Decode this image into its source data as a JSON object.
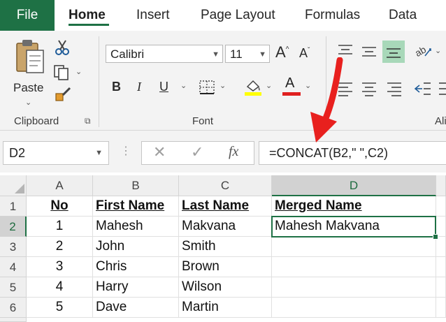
{
  "tabs": [
    "File",
    "Home",
    "Insert",
    "Page Layout",
    "Formulas",
    "Data"
  ],
  "ribbon": {
    "clipboard": {
      "paste_label": "Paste",
      "group_label": "Clipboard"
    },
    "font": {
      "font_name": "Calibri",
      "font_size": "11",
      "bold": "B",
      "italic": "I",
      "underline": "U",
      "font_color_glyph": "A",
      "grow_glyph": "A",
      "shrink_glyph": "A",
      "group_label": "Font",
      "highlight_color": "#ffff00",
      "font_color": "#e0201f"
    },
    "alignment": {
      "group_label_partial": "Ali"
    }
  },
  "formula_bar": {
    "name_box": "D2",
    "cancel_glyph": "✕",
    "enter_glyph": "✓",
    "fx_glyph": "fx",
    "formula": "=CONCAT(B2,\" \",C2)"
  },
  "grid": {
    "columns": [
      "A",
      "B",
      "C",
      "D"
    ],
    "rows": [
      "1",
      "2",
      "3",
      "4",
      "5",
      "6"
    ],
    "selected_cell": "D2",
    "headers": [
      "No",
      "First Name",
      "Last Name",
      "Merged Name"
    ],
    "data": [
      {
        "no": "1",
        "first": "Mahesh",
        "last": "Makvana",
        "merged": "Mahesh Makvana"
      },
      {
        "no": "2",
        "first": "John",
        "last": "Smith",
        "merged": ""
      },
      {
        "no": "3",
        "first": "Chris",
        "last": "Brown",
        "merged": ""
      },
      {
        "no": "4",
        "first": "Harry",
        "last": "Wilson",
        "merged": ""
      },
      {
        "no": "5",
        "first": "Dave",
        "last": "Martin",
        "merged": ""
      }
    ]
  },
  "colors": {
    "accent": "#1e7145",
    "arrow": "#e8201e"
  }
}
